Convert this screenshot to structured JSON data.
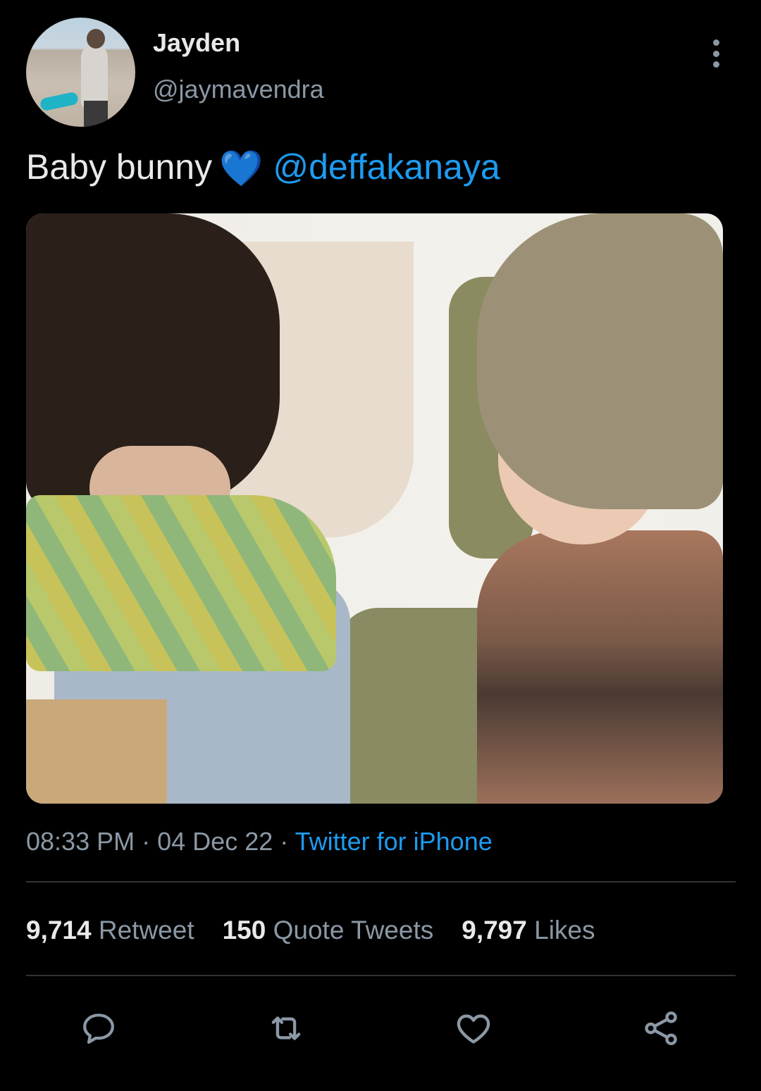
{
  "author": {
    "name": "Jayden",
    "handle": "@jaymavendra"
  },
  "tweet": {
    "text": "Baby bunny",
    "emoji": "💙",
    "mention": "@deffakanaya"
  },
  "meta": {
    "time": "08:33 PM",
    "sep": "·",
    "date": "04 Dec 22",
    "source": "Twitter for iPhone"
  },
  "stats": {
    "retweets": {
      "count": "9,714",
      "label": "Retweet"
    },
    "quotes": {
      "count": "150",
      "label": "Quote Tweets"
    },
    "likes": {
      "count": "9,797",
      "label": "Likes"
    }
  },
  "icons": [
    "more-icon",
    "reply-icon",
    "retweet-icon",
    "like-icon",
    "share-icon"
  ],
  "colors": {
    "background": "#000000",
    "text": "#e7e9ea",
    "muted": "#8b98a5",
    "accent": "#1d9bf0",
    "divider": "#2f3336"
  }
}
